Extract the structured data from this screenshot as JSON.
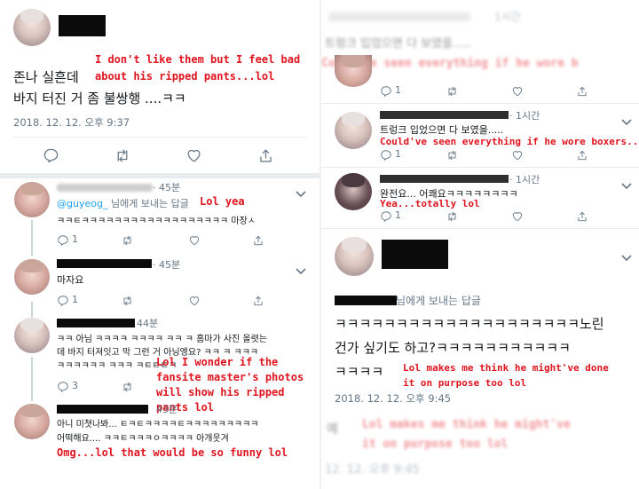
{
  "left": {
    "main_tweet": {
      "text_line1": "존나 실흔데",
      "text_line2": "바지 터진 거 좀 불쌍행 ....ㅋㅋ",
      "timestamp": "2018. 12. 12. 오후 9:37",
      "translation": "I don't like them but I feel bad\nabout his ripped pants...lol"
    },
    "replies": [
      {
        "time": "· 45분",
        "reply_to_handle": "@guyeog_",
        "reply_to_suffix": " 님에게 보내는 답글",
        "text": "ㅋㅋㅌㅋㅋㅋㅋㅋㅋㅋㅋㅋㅋㅋㅋㅋㅋㅋㅋㅋㅋ 마장ㅅ",
        "reply_count": "1",
        "translation": "Lol yea"
      },
      {
        "time": "· 45분",
        "text": "마자요",
        "reply_count": "1"
      },
      {
        "time": "44분",
        "text_line1": "ㅋㅋ 아님 ㅋㅋㅋㅋ ㅋㅋㅋㅋ ㅋㅋ ㅋ 홈마가 사진 올렷는",
        "text_line2": "데 바지 터져잇고 막 그런 거 아닝엥요? ㅋㅋ ㅋ ㅋㅋㅋ",
        "text_line3": "ㅋㅋㅋㅋㅋㅋ ㅋㅋㅋ ㅋㅌㅌㅌㅋ",
        "reply_count": "3",
        "translation": "Lol I wonder if the\nfansite master's photos\nwill show his ripped\npants lol"
      },
      {
        "time": "43분",
        "text_line1": "아니 미쳣나봐... ㅌㅋㅌㅋㅋㅋㅋㅌㅋㅋㅋㅋㅋㅋㅋㅋㅋ",
        "text_line2": "어떡해요.... ㅋㅋㅌㅋㅋㅋㅇㅋㅋㅋㅋ 아개웃겨",
        "translation": "Omg...lol that would be so funny lol"
      }
    ]
  },
  "right": {
    "top_blur_time": "1시간",
    "top_blur_text": "트렁크 입었으면 다 보였을.....",
    "top_blur_translation": "Could've seen everything if he wore b",
    "replies": [
      {
        "reply_count": "1"
      },
      {
        "time": "· 1시간",
        "text": "트렁크 입었으면 다 보였을.....",
        "translation": "Could've seen everything if he wore boxers...",
        "reply_count": "1"
      },
      {
        "time": "· 1시간",
        "text": "완전요... 어쾌요ㅋㅋㅋㅋㅋㅋㅋㅋ",
        "translation": "Yea...totally lol",
        "reply_count": "1"
      }
    ],
    "main_tweet": {
      "reply_to_suffix": "님에게 보내는 답글",
      "text_line1": "ㅋㅋㅋㅋㅋㅋㅋㅋㅋㅋㅋㅋㅋㅋㅋㅋㅋㅋㅋㅋ노린",
      "text_line2": "건가 싶기도 하고?ㅋㅋㅋㅋㅋㅋㅋㅋㅋㅋㅋ",
      "text_line3": "ㅋㅋㅋㅋ",
      "timestamp": "2018. 12. 12. 오후 9:45",
      "translation": "Lol makes me think he might've done\nit on purpose too lol"
    },
    "bottom_blur": {
      "text": "예",
      "translation": "Lol makes me think he might've\nit on purpose too lol",
      "timestamp": "12. 12. 오후 9:45"
    }
  }
}
